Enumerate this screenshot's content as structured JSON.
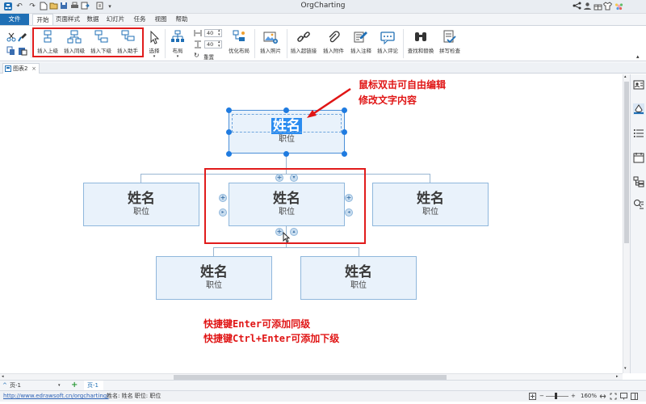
{
  "app": {
    "title": "OrgCharting"
  },
  "menu": {
    "tabs": [
      "文件",
      "开始",
      "页面样式",
      "数据",
      "幻灯片",
      "任务",
      "视图",
      "帮助"
    ]
  },
  "ribbon": {
    "insert_superior": "插入上级",
    "insert_same_level": "插入同级",
    "insert_subordinate": "插入下级",
    "insert_assistant": "插入助手",
    "select": "选择",
    "layout": "布局",
    "spin1": "40",
    "spin2": "40",
    "reset": "重置",
    "optimize_layout": "优化布局",
    "insert_image": "插入照片",
    "insert_hyperlink": "插入超链接",
    "insert_attachment": "插入附件",
    "insert_note": "插入注释",
    "insert_comment": "插入评论",
    "find_replace": "查找和替换",
    "spell_check": "拼写检查"
  },
  "doc": {
    "tab": "图表2"
  },
  "chart": {
    "nodes": [
      {
        "name": "姓名",
        "position": "职位"
      },
      {
        "name": "姓名",
        "position": "职位"
      },
      {
        "name": "姓名",
        "position": "职位"
      },
      {
        "name": "姓名",
        "position": "职位"
      },
      {
        "name": "姓名",
        "position": "职位"
      },
      {
        "name": "姓名",
        "position": "职位"
      }
    ]
  },
  "annotations": {
    "top_line1": "鼠标双击可自由编辑",
    "top_line2": "修改文字内容",
    "bottom_line1": "快捷键Enter可添加同级",
    "bottom_line2": "快捷键Ctrl+Enter可添加下级"
  },
  "pagebar": {
    "page_select": "页-1",
    "page_tab": "页-1"
  },
  "status": {
    "url": "http://www.edrawsoft.cn/orgcharting/",
    "selection": "姓名: 姓名  职位: 职位",
    "zoom": "160%"
  },
  "colors": {
    "accent": "#1f6fb5",
    "highlight": "#e11c1c",
    "node_fill": "#e9f2fb",
    "node_border": "#8fb7dc"
  }
}
